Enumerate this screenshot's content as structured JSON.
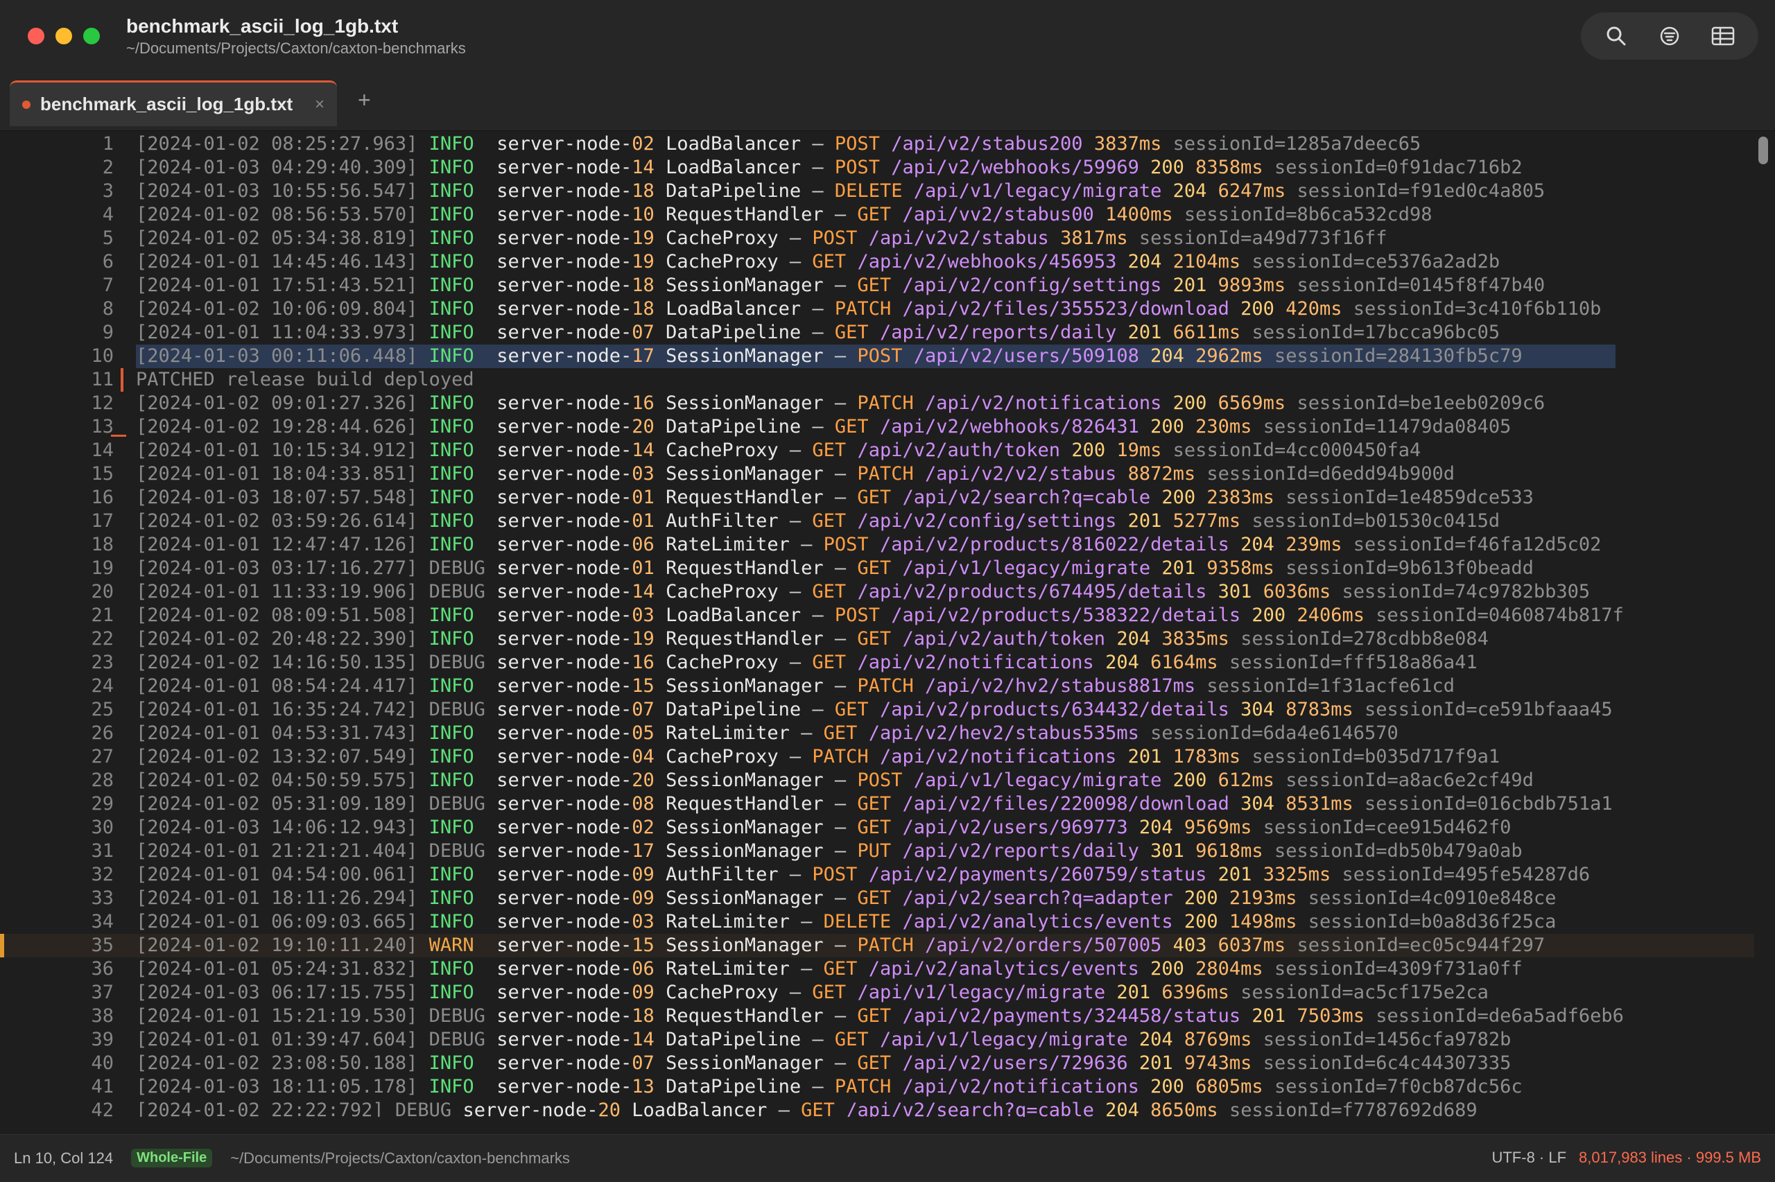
{
  "window": {
    "title": "benchmark_ascii_log_1gb.txt",
    "subtitle": "~/Documents/Projects/Caxton/caxton-benchmarks",
    "toolbar_icons": [
      "search-icon",
      "filter-icon",
      "columns-icon"
    ]
  },
  "tab": {
    "label": "benchmark_ascii_log_1gb.txt",
    "close": "×",
    "add": "+"
  },
  "log_lines": [
    {
      "n": "1",
      "ts": "[2024-01-02 08:25:27.963]",
      "lv": "INFO",
      "nn": "02",
      "comp": "LoadBalancer",
      "m": "POST",
      "p": "/api/v2/stabus200",
      "s": "",
      "d": "3837ms",
      "sid": "1285a7deec65"
    },
    {
      "n": "2",
      "ts": "[2024-01-03 04:29:40.309]",
      "lv": "INFO",
      "nn": "14",
      "comp": "LoadBalancer",
      "m": "POST",
      "p": "/api/v2/webhooks/59969",
      "s": "200",
      "d": "8358ms",
      "sid": "0f91dac716b2"
    },
    {
      "n": "3",
      "ts": "[2024-01-03 10:55:56.547]",
      "lv": "INFO",
      "nn": "18",
      "comp": "DataPipeline",
      "m": "DELETE",
      "p": "/api/v1/legacy/migrate",
      "s": "204",
      "d": "6247ms",
      "sid": "f91ed0c4a805"
    },
    {
      "n": "4",
      "ts": "[2024-01-02 08:56:53.570]",
      "lv": "INFO",
      "nn": "10",
      "comp": "RequestHandler",
      "m": "GET",
      "p": "/api/vv2/stabus00",
      "s": "",
      "d": "1400ms",
      "sid": "8b6ca532cd98"
    },
    {
      "n": "5",
      "ts": "[2024-01-02 05:34:38.819]",
      "lv": "INFO",
      "nn": "19",
      "comp": "CacheProxy",
      "m": "POST",
      "p": "/api/v2v2/stabus",
      "s": "",
      "d": "3817ms",
      "sid": "a49d773f16ff"
    },
    {
      "n": "6",
      "ts": "[2024-01-01 14:45:46.143]",
      "lv": "INFO",
      "nn": "19",
      "comp": "CacheProxy",
      "m": "GET",
      "p": "/api/v2/webhooks/456953",
      "s": "204",
      "d": "2104ms",
      "sid": "ce5376a2ad2b"
    },
    {
      "n": "7",
      "ts": "[2024-01-01 17:51:43.521]",
      "lv": "INFO",
      "nn": "18",
      "comp": "SessionManager",
      "m": "GET",
      "p": "/api/v2/config/settings",
      "s": "201",
      "d": "9893ms",
      "sid": "0145f8f47b40"
    },
    {
      "n": "8",
      "ts": "[2024-01-02 10:06:09.804]",
      "lv": "INFO",
      "nn": "18",
      "comp": "LoadBalancer",
      "m": "PATCH",
      "p": "/api/v2/files/355523/download",
      "s": "200",
      "d": "420ms",
      "sid": "3c410f6b110b"
    },
    {
      "n": "9",
      "ts": "[2024-01-01 11:04:33.973]",
      "lv": "INFO",
      "nn": "07",
      "comp": "DataPipeline",
      "m": "GET",
      "p": "/api/v2/reports/daily",
      "s": "201",
      "d": "6611ms",
      "sid": "17bcca96bc05"
    },
    {
      "n": "10",
      "ts": "[2024-01-03 00:11:06.448]",
      "lv": "INFO",
      "nn": "17",
      "comp": "SessionManager",
      "m": "POST",
      "p": "/api/v2/users/509108",
      "s": "204",
      "d": "2962ms",
      "sid": "284130fb5c79"
    },
    {
      "n": "11",
      "raw": "PATCHED release build deployed"
    },
    {
      "n": "12",
      "ts": "[2024-01-02 09:01:27.326]",
      "lv": "INFO",
      "nn": "16",
      "comp": "SessionManager",
      "m": "PATCH",
      "p": "/api/v2/notifications",
      "s": "200",
      "d": "6569ms",
      "sid": "be1eeb0209c6"
    },
    {
      "n": "13",
      "ts": "[2024-01-02 19:28:44.626]",
      "lv": "INFO",
      "nn": "20",
      "comp": "DataPipeline",
      "m": "GET",
      "p": "/api/v2/webhooks/826431",
      "s": "200",
      "d": "230ms",
      "sid": "11479da08405"
    },
    {
      "n": "14",
      "ts": "[2024-01-01 10:15:34.912]",
      "lv": "INFO",
      "nn": "14",
      "comp": "CacheProxy",
      "m": "GET",
      "p": "/api/v2/auth/token",
      "s": "200",
      "d": "19ms",
      "sid": "4cc000450fa4"
    },
    {
      "n": "15",
      "ts": "[2024-01-01 18:04:33.851]",
      "lv": "INFO",
      "nn": "03",
      "comp": "SessionManager",
      "m": "PATCH",
      "p": "/api/v2/v2/stabus",
      "s": "",
      "d": "8872ms",
      "sid": "d6edd94b900d"
    },
    {
      "n": "16",
      "ts": "[2024-01-03 18:07:57.548]",
      "lv": "INFO",
      "nn": "01",
      "comp": "RequestHandler",
      "m": "GET",
      "p": "/api/v2/search?q=cable",
      "s": "200",
      "d": "2383ms",
      "sid": "1e4859dce533"
    },
    {
      "n": "17",
      "ts": "[2024-01-02 03:59:26.614]",
      "lv": "INFO",
      "nn": "01",
      "comp": "AuthFilter",
      "m": "GET",
      "p": "/api/v2/config/settings",
      "s": "201",
      "d": "5277ms",
      "sid": "b01530c0415d"
    },
    {
      "n": "18",
      "ts": "[2024-01-01 12:47:47.126]",
      "lv": "INFO",
      "nn": "06",
      "comp": "RateLimiter",
      "m": "POST",
      "p": "/api/v2/products/816022/details",
      "s": "204",
      "d": "239ms",
      "sid": "f46fa12d5c02"
    },
    {
      "n": "19",
      "ts": "[2024-01-03 03:17:16.277]",
      "lv": "DEBUG",
      "nn": "01",
      "comp": "RequestHandler",
      "m": "GET",
      "p": "/api/v1/legacy/migrate",
      "s": "201",
      "d": "9358ms",
      "sid": "9b613f0beadd"
    },
    {
      "n": "20",
      "ts": "[2024-01-01 11:33:19.906]",
      "lv": "DEBUG",
      "nn": "14",
      "comp": "CacheProxy",
      "m": "GET",
      "p": "/api/v2/products/674495/details",
      "s": "301",
      "d": "6036ms",
      "sid": "74c9782bb305"
    },
    {
      "n": "21",
      "ts": "[2024-01-02 08:09:51.508]",
      "lv": "INFO",
      "nn": "03",
      "comp": "LoadBalancer",
      "m": "POST",
      "p": "/api/v2/products/538322/details",
      "s": "200",
      "d": "2406ms",
      "sid": "0460874b817f"
    },
    {
      "n": "22",
      "ts": "[2024-01-02 20:48:22.390]",
      "lv": "INFO",
      "nn": "19",
      "comp": "RequestHandler",
      "m": "GET",
      "p": "/api/v2/auth/token",
      "s": "204",
      "d": "3835ms",
      "sid": "278cdbb8e084"
    },
    {
      "n": "23",
      "ts": "[2024-01-02 14:16:50.135]",
      "lv": "DEBUG",
      "nn": "16",
      "comp": "CacheProxy",
      "m": "GET",
      "p": "/api/v2/notifications",
      "s": "204",
      "d": "6164ms",
      "sid": "fff518a86a41"
    },
    {
      "n": "24",
      "ts": "[2024-01-01 08:54:24.417]",
      "lv": "INFO",
      "nn": "15",
      "comp": "SessionManager",
      "m": "PATCH",
      "p": "/api/v2/hv2/stabus8817ms",
      "s": "",
      "d": "",
      "sid": "1f31acfe61cd"
    },
    {
      "n": "25",
      "ts": "[2024-01-01 16:35:24.742]",
      "lv": "DEBUG",
      "nn": "07",
      "comp": "DataPipeline",
      "m": "GET",
      "p": "/api/v2/products/634432/details",
      "s": "304",
      "d": "8783ms",
      "sid": "ce591bfaaa45"
    },
    {
      "n": "26",
      "ts": "[2024-01-01 04:53:31.743]",
      "lv": "INFO",
      "nn": "05",
      "comp": "RateLimiter",
      "m": "GET",
      "p": "/api/v2/hev2/stabus535ms",
      "s": "",
      "d": "",
      "sid": "6da4e6146570"
    },
    {
      "n": "27",
      "ts": "[2024-01-02 13:32:07.549]",
      "lv": "INFO",
      "nn": "04",
      "comp": "CacheProxy",
      "m": "PATCH",
      "p": "/api/v2/notifications",
      "s": "201",
      "d": "1783ms",
      "sid": "b035d717f9a1"
    },
    {
      "n": "28",
      "ts": "[2024-01-02 04:50:59.575]",
      "lv": "INFO",
      "nn": "20",
      "comp": "SessionManager",
      "m": "POST",
      "p": "/api/v1/legacy/migrate",
      "s": "200",
      "d": "612ms",
      "sid": "a8ac6e2cf49d"
    },
    {
      "n": "29",
      "ts": "[2024-01-02 05:31:09.189]",
      "lv": "DEBUG",
      "nn": "08",
      "comp": "RequestHandler",
      "m": "GET",
      "p": "/api/v2/files/220098/download",
      "s": "304",
      "d": "8531ms",
      "sid": "016cbdb751a1"
    },
    {
      "n": "30",
      "ts": "[2024-01-03 14:06:12.943]",
      "lv": "INFO",
      "nn": "02",
      "comp": "SessionManager",
      "m": "GET",
      "p": "/api/v2/users/969773",
      "s": "204",
      "d": "9569ms",
      "sid": "cee915d462f0"
    },
    {
      "n": "31",
      "ts": "[2024-01-01 21:21:21.404]",
      "lv": "DEBUG",
      "nn": "17",
      "comp": "SessionManager",
      "m": "PUT",
      "p": "/api/v2/reports/daily",
      "s": "301",
      "d": "9618ms",
      "sid": "db50b479a0ab"
    },
    {
      "n": "32",
      "ts": "[2024-01-01 04:54:00.061]",
      "lv": "INFO",
      "nn": "09",
      "comp": "AuthFilter",
      "m": "POST",
      "p": "/api/v2/payments/260759/status",
      "s": "201",
      "d": "3325ms",
      "sid": "495fe54287d6"
    },
    {
      "n": "33",
      "ts": "[2024-01-01 18:11:26.294]",
      "lv": "INFO",
      "nn": "09",
      "comp": "SessionManager",
      "m": "GET",
      "p": "/api/v2/search?q=adapter",
      "s": "200",
      "d": "2193ms",
      "sid": "4c0910e848ce"
    },
    {
      "n": "34",
      "ts": "[2024-01-01 06:09:03.665]",
      "lv": "INFO",
      "nn": "03",
      "comp": "RateLimiter",
      "m": "DELETE",
      "p": "/api/v2/analytics/events",
      "s": "200",
      "d": "1498ms",
      "sid": "b0a8d36f25ca"
    },
    {
      "n": "35",
      "ts": "[2024-01-02 19:10:11.240]",
      "lv": "WARN",
      "nn": "15",
      "comp": "SessionManager",
      "m": "PATCH",
      "p": "/api/v2/orders/507005",
      "s": "403",
      "d": "6037ms",
      "sid": "ec05c944f297"
    },
    {
      "n": "36",
      "ts": "[2024-01-01 05:24:31.832]",
      "lv": "INFO",
      "nn": "06",
      "comp": "RateLimiter",
      "m": "GET",
      "p": "/api/v2/analytics/events",
      "s": "200",
      "d": "2804ms",
      "sid": "4309f731a0ff"
    },
    {
      "n": "37",
      "ts": "[2024-01-03 06:17:15.755]",
      "lv": "INFO",
      "nn": "09",
      "comp": "CacheProxy",
      "m": "GET",
      "p": "/api/v1/legacy/migrate",
      "s": "201",
      "d": "6396ms",
      "sid": "ac5cf175e2ca"
    },
    {
      "n": "38",
      "ts": "[2024-01-01 15:21:19.530]",
      "lv": "DEBUG",
      "nn": "18",
      "comp": "RequestHandler",
      "m": "GET",
      "p": "/api/v2/payments/324458/status",
      "s": "201",
      "d": "7503ms",
      "sid": "de6a5adf6eb6"
    },
    {
      "n": "39",
      "ts": "[2024-01-01 01:39:47.604]",
      "lv": "DEBUG",
      "nn": "14",
      "comp": "DataPipeline",
      "m": "GET",
      "p": "/api/v1/legacy/migrate",
      "s": "204",
      "d": "8769ms",
      "sid": "1456cfa9782b"
    },
    {
      "n": "40",
      "ts": "[2024-01-02 23:08:50.188]",
      "lv": "INFO",
      "nn": "07",
      "comp": "SessionManager",
      "m": "GET",
      "p": "/api/v2/users/729636",
      "s": "201",
      "d": "9743ms",
      "sid": "6c4c44307335"
    },
    {
      "n": "41",
      "ts": "[2024-01-03 18:11:05.178]",
      "lv": "INFO",
      "nn": "13",
      "comp": "DataPipeline",
      "m": "PATCH",
      "p": "/api/v2/notifications",
      "s": "200",
      "d": "6805ms",
      "sid": "7f0cb87dc56c"
    },
    {
      "n": "42",
      "ts": "[2024-01-02 22:22:792]",
      "lv": "DEBUG",
      "nn": "20",
      "comp": "LoadBalancer",
      "m": "GET",
      "p": "/api/v2/search?q=cable",
      "s": "204",
      "d": "8650ms",
      "sid": "f7787692d689"
    }
  ],
  "highlight_line": 10,
  "warn_line": 35,
  "statusbar": {
    "position": "Ln 10, Col 124",
    "mode": "Whole-File",
    "path": "~/Documents/Projects/Caxton/caxton-benchmarks",
    "encoding": "UTF-8 · LF",
    "lines_size": "8,017,983 lines · 999.5 MB"
  },
  "colors": {
    "accent": "#e05a33",
    "info": "#5ee07a",
    "warn": "#f2a94a",
    "method": "#ff9f43",
    "path": "#cf8ef7"
  }
}
